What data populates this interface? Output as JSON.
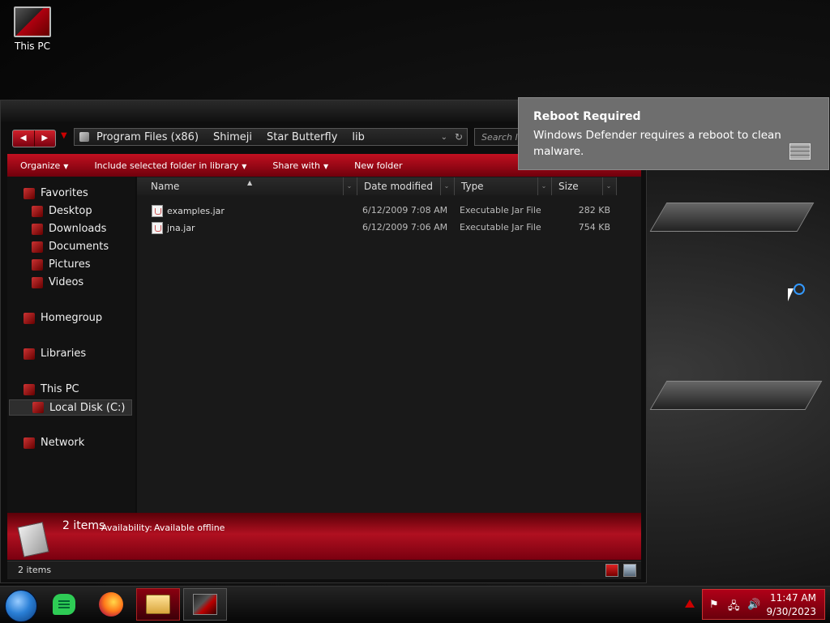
{
  "desktop": {
    "icons": [
      {
        "label": "This PC",
        "icon": "computer-icon"
      }
    ]
  },
  "explorer": {
    "address": {
      "crumbs": [
        "Program Files (x86)",
        "Shimeji",
        "Star Butterfly",
        "lib"
      ],
      "search_placeholder": "Search lib"
    },
    "toolbar": {
      "organize": "Organize",
      "include": "Include selected folder in library",
      "share": "Share with",
      "new_folder": "New folder"
    },
    "nav": {
      "favorites": "Favorites",
      "desktop": "Desktop",
      "downloads": "Downloads",
      "documents": "Documents",
      "pictures": "Pictures",
      "videos": "Videos",
      "homegroup": "Homegroup",
      "libraries": "Libraries",
      "this_pc": "This PC",
      "local_disk": "Local Disk (C:)",
      "network": "Network"
    },
    "columns": {
      "name": "Name",
      "date": "Date modified",
      "type": "Type",
      "size": "Size"
    },
    "files": [
      {
        "name": "examples.jar",
        "date": "6/12/2009 7:08 AM",
        "type": "Executable Jar File",
        "size": "282 KB"
      },
      {
        "name": "jna.jar",
        "date": "6/12/2009 7:06 AM",
        "type": "Executable Jar File",
        "size": "754 KB"
      }
    ],
    "details": {
      "count": "2 items",
      "availability_label": "Availability:",
      "availability_value": "Available offline"
    },
    "status": {
      "items": "2 items"
    }
  },
  "toast": {
    "title": "Reboot Required",
    "message": "Windows Defender requires a reboot to clean malware.",
    "icon": "firewall-icon"
  },
  "taskbar": {
    "apps": [
      "start-orb",
      "notes-app",
      "firefox",
      "file-explorer",
      "window-app"
    ],
    "time": "11:47 AM",
    "date": "9/30/2023"
  }
}
